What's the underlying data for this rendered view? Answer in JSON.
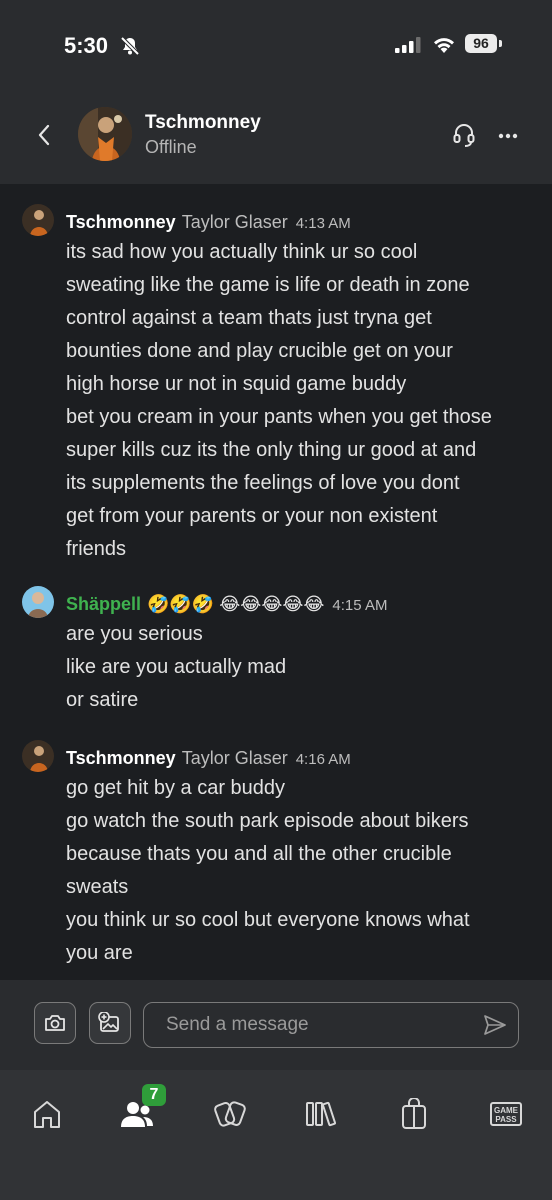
{
  "status_bar": {
    "time": "5:30",
    "battery": "96"
  },
  "header": {
    "name": "Tschmonney",
    "status": "Offline"
  },
  "messages": [
    {
      "sender": "Tschmonney",
      "real_name": "Taylor Glaser",
      "time": "4:13 AM",
      "emoji": "",
      "lines": [
        "its sad how you actually think ur so cool",
        "sweating like the game is life or death in zone",
        "control against a team thats just tryna get",
        "bounties done and play crucible get on your",
        "high horse ur not in squid game buddy",
        "bet you cream in your pants when you get those",
        "super kills cuz its the only thing ur good at and",
        "its supplements the feelings of love you dont",
        "get from your parents or your non existent",
        "friends"
      ]
    },
    {
      "sender": "Shäppell",
      "real_name": "",
      "time": "4:15 AM",
      "emoji": "🤣🤣🤣 😂😂😂😂😂",
      "lines": [
        "are you serious",
        "like are you actually mad",
        "or satire"
      ]
    },
    {
      "sender": "Tschmonney",
      "real_name": "Taylor Glaser",
      "time": "4:16 AM",
      "emoji": "",
      "lines": [
        "go get hit by a car buddy",
        "go watch the south park episode about bikers",
        "because thats you and all the other crucible",
        "sweats",
        "you think ur so cool but everyone knows what",
        "you are"
      ]
    }
  ],
  "composer": {
    "placeholder": "Send a message"
  },
  "tabs": {
    "friends_badge": "7",
    "gamepass_line1": "GAME",
    "gamepass_line2": "PASS"
  },
  "icons": [
    "bell-slash-icon",
    "signal-icon",
    "wifi-icon",
    "back-chevron-icon",
    "headset-icon",
    "more-icon",
    "camera-icon",
    "image-add-icon",
    "send-icon",
    "home-icon",
    "friends-icon",
    "social-icon",
    "library-icon",
    "store-icon",
    "game-pass-icon"
  ]
}
